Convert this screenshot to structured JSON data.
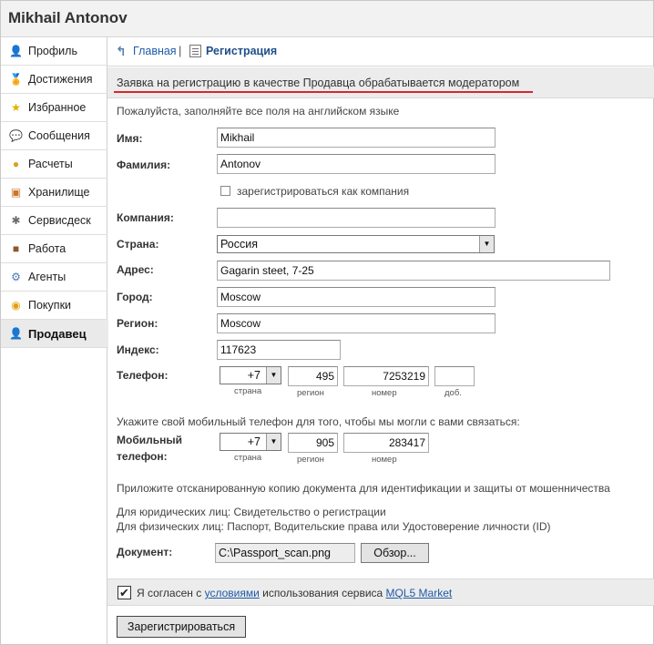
{
  "header": {
    "title": "Mikhail Antonov"
  },
  "sidebar": {
    "items": [
      {
        "label": "Профиль",
        "icon": "profile-icon",
        "glyph": "👤",
        "color": "#3a5f8f"
      },
      {
        "label": "Достижения",
        "icon": "medal-icon",
        "glyph": "🏅",
        "color": "#c8941b"
      },
      {
        "label": "Избранное",
        "icon": "star-icon",
        "glyph": "★",
        "color": "#e2b100"
      },
      {
        "label": "Сообщения",
        "icon": "chat-icon",
        "glyph": "💬",
        "color": "#3a7bc8"
      },
      {
        "label": "Расчеты",
        "icon": "coins-icon",
        "glyph": "●",
        "color": "#d7a21f"
      },
      {
        "label": "Хранилище",
        "icon": "storage-icon",
        "glyph": "▣",
        "color": "#c7772a"
      },
      {
        "label": "Сервисдеск",
        "icon": "tools-icon",
        "glyph": "✱",
        "color": "#6b6b6b"
      },
      {
        "label": "Работа",
        "icon": "briefcase-icon",
        "glyph": "■",
        "color": "#8a5a2b"
      },
      {
        "label": "Агенты",
        "icon": "gear-icon",
        "glyph": "⚙",
        "color": "#4a78b5"
      },
      {
        "label": "Покупки",
        "icon": "cart-icon",
        "glyph": "◉",
        "color": "#e0a010"
      },
      {
        "label": "Продавец",
        "icon": "seller-icon",
        "glyph": "👤",
        "color": "#555555"
      }
    ],
    "active_index": 10
  },
  "breadcrumb": {
    "home": "Главная",
    "separator": "|",
    "current": "Регистрация"
  },
  "notice": "Заявка на регистрацию в качестве Продавца обрабатывается модератором",
  "form": {
    "hint_english": "Пожалуйста, заполняйте все поля на английском языке",
    "first_name": {
      "label": "Имя:",
      "value": "Mikhail"
    },
    "last_name": {
      "label": "Фамилия:",
      "value": "Antonov"
    },
    "as_company": {
      "label": "зарегистрироваться как компания",
      "checked": false
    },
    "company": {
      "label": "Компания:",
      "value": ""
    },
    "country": {
      "label": "Страна:",
      "value": "Россия"
    },
    "address": {
      "label": "Адрес:",
      "value": "Gagarin steet, 7-25"
    },
    "city": {
      "label": "Город:",
      "value": "Moscow"
    },
    "region": {
      "label": "Регион:",
      "value": "Moscow"
    },
    "zip": {
      "label": "Индекс:",
      "value": "117623"
    },
    "phone": {
      "label": "Телефон:",
      "country_code": "+7",
      "region_code": "495",
      "number": "7253219",
      "ext": "",
      "sub_country": "страна",
      "sub_region": "регион",
      "sub_number": "номер",
      "sub_ext": "доб."
    },
    "mobile_hint": "Укажите свой мобильный телефон для того, чтобы мы могли с вами связаться:",
    "mobile": {
      "label_line1": "Мобильный",
      "label_line2": "телефон:",
      "country_code": "+7",
      "region_code": "905",
      "number": "283417",
      "sub_country": "страна",
      "sub_region": "регион",
      "sub_number": "номер"
    },
    "doc_hint": "Приложите отсканированную копию документа для идентификации и защиты от мошенничества",
    "doc_legal": "Для юридических лиц: Свидетельство о регистрации",
    "doc_personal": "Для физических лиц: Паспорт, Водительские права или Удостоверение личности (ID)",
    "document": {
      "label": "Документ:",
      "value": "C:\\Passport_scan.png",
      "browse": "Обзор..."
    },
    "agree": {
      "checked": true,
      "prefix": "Я согласен с ",
      "terms_link": "условиями",
      "middle": " использования сервиса ",
      "service_link": "MQL5 Market"
    },
    "submit": "Зарегистрироваться"
  },
  "colors": {
    "accent_red": "#d9262b",
    "link_blue": "#1f5aa6"
  }
}
